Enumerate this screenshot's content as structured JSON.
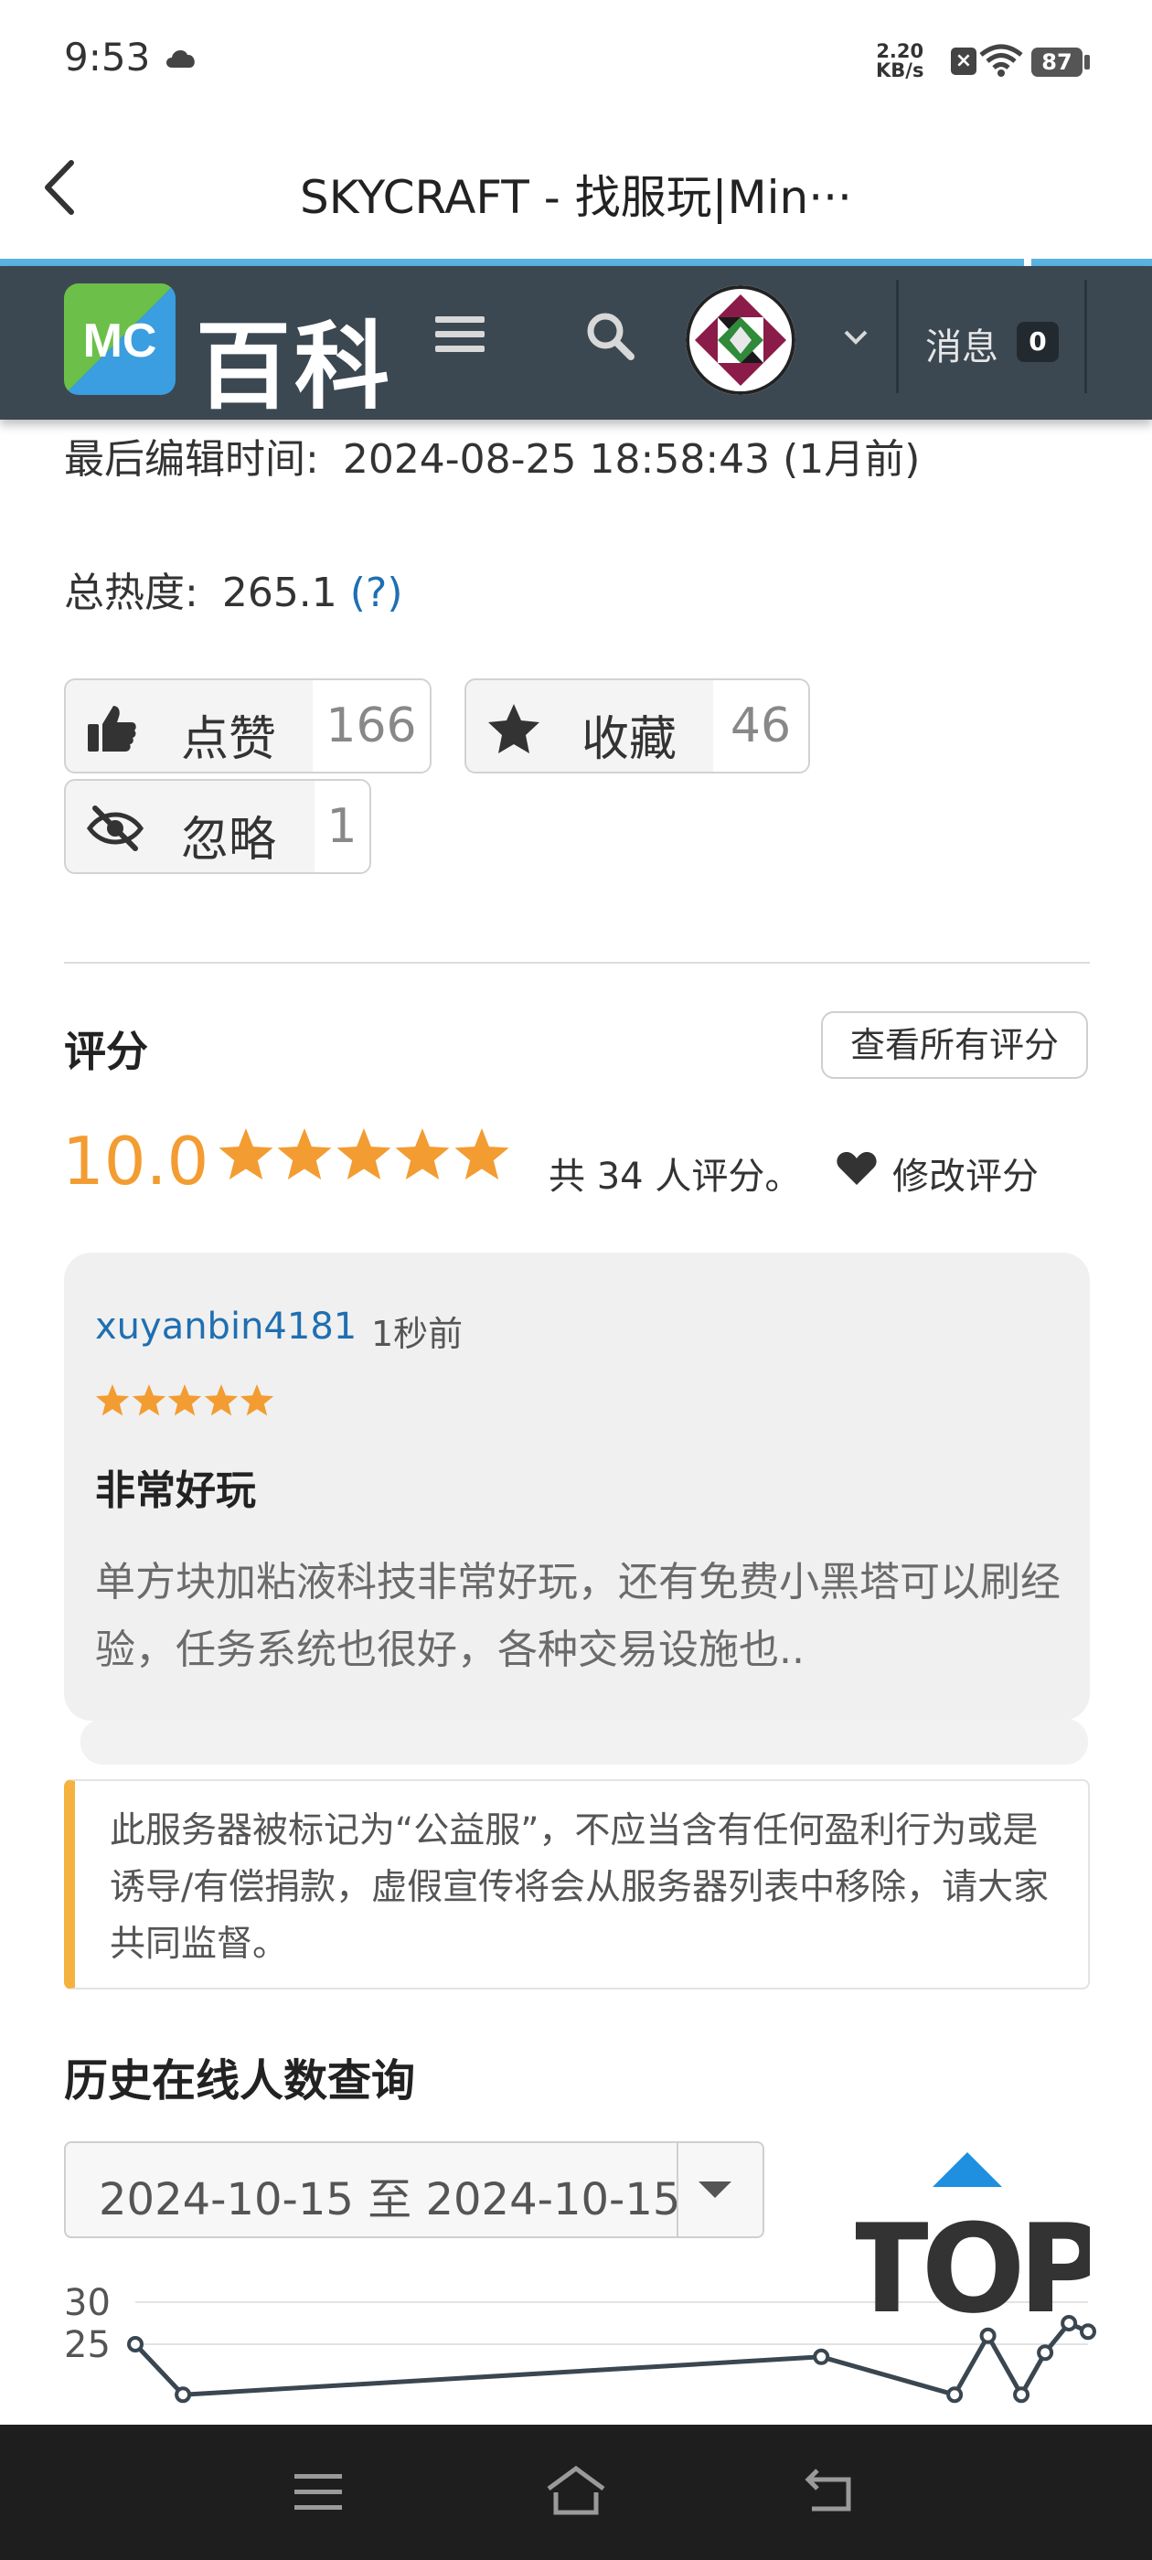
{
  "status_bar": {
    "time": "9:53",
    "net_speed_value": "2.20",
    "net_speed_unit": "KB/s",
    "battery": "87",
    "icons": [
      "cloud-icon",
      "no-sim-icon",
      "wifi-icon",
      "battery-icon"
    ]
  },
  "app_bar": {
    "title": "SKYCRAFT - 找服玩|Min···"
  },
  "site_header": {
    "logo_badge": "MC",
    "logo_text": "百科",
    "messages_label": "消息",
    "messages_count": "0"
  },
  "info": {
    "edited_label": "最后编辑时间:",
    "edited_value": "2024-08-25 18:58:43 (1月前)",
    "heat_label": "总热度:",
    "heat_value": "265.1",
    "heat_help": "(?)"
  },
  "actions": {
    "like_label": "点赞",
    "like_count": "166",
    "fav_label": "收藏",
    "fav_count": "46",
    "ignore_label": "忽略",
    "ignore_count": "1"
  },
  "rating": {
    "title": "评分",
    "view_all": "查看所有评分",
    "score": "10.0",
    "stars": 5,
    "count_text": "共 34 人评分。",
    "modify_label": "修改评分"
  },
  "review": {
    "user": "xuyanbin4181",
    "time": "1秒前",
    "stars": 5,
    "title": "非常好玩",
    "body": "单方块加粘液科技非常好玩，还有免费小黑塔可以刷经验，任务系统也很好，各种交易设施也.."
  },
  "notice": {
    "text": "此服务器被标记为“公益服”，不应当含有任何盈利行为或是诱导/有偿捐款，虚假宣传将会从服务器列表中移除，请大家共同监督。"
  },
  "history": {
    "title": "历史在线人数查询",
    "date_range": "2024-10-15 至 2024-10-15",
    "top_button": "TOP"
  },
  "chart_data": {
    "type": "line",
    "yticks": [
      "30",
      "25"
    ],
    "ylim": [
      20,
      30
    ],
    "grid": true,
    "series": [
      {
        "values": [
          {
            "x": 0.0,
            "y": 25.0
          },
          {
            "x": 0.05,
            "y": 19.0
          },
          {
            "x": 0.72,
            "y": 23.5
          },
          {
            "x": 0.86,
            "y": 19.0
          },
          {
            "x": 0.895,
            "y": 26.0
          },
          {
            "x": 0.93,
            "y": 19.0
          },
          {
            "x": 0.955,
            "y": 24.0
          },
          {
            "x": 0.98,
            "y": 27.5
          },
          {
            "x": 1.0,
            "y": 26.5
          }
        ]
      }
    ],
    "colors": {
      "line": "#3a4650",
      "grid": "#e3e3e3"
    }
  },
  "colors": {
    "header_bg": "#3b4852",
    "accent_blue": "#1f6fb2",
    "star_orange": "#f39c32",
    "notice_border": "#f4b23e",
    "top_arrow": "#1f8fe0"
  }
}
